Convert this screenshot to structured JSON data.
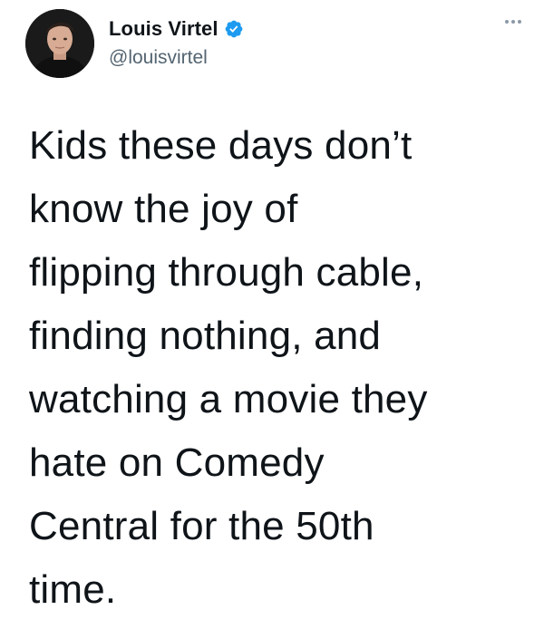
{
  "author": {
    "display_name": "Louis Virtel",
    "handle": "@louisvirtel",
    "verified": true,
    "verified_color": "#1d9bf0"
  },
  "icons": {
    "verified": "verified-badge-icon",
    "more": "more-horizontal-icon"
  },
  "tweet": {
    "text": "Kids these days don’t\nknow the joy of\nflipping through cable,\nfinding nothing, and\nwatching a movie they\nhate on Comedy\nCentral for the 50th\ntime."
  }
}
